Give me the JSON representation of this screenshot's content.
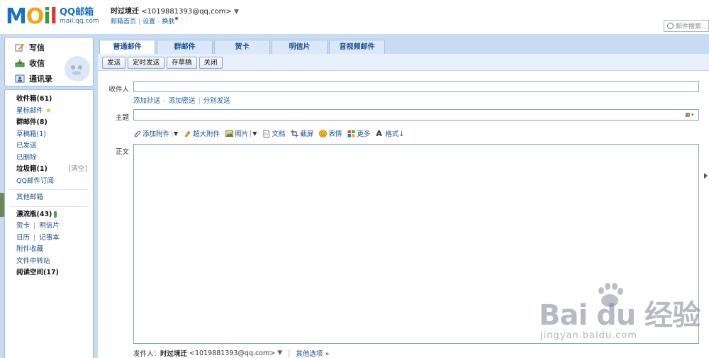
{
  "header": {
    "logo_text": "MOil",
    "logo_cn": "QQ邮箱",
    "logo_domain": "mail.qq.com",
    "user_name": "时过境迁",
    "user_email": "<1019881393@qq.com>",
    "links": [
      "邮箱首页",
      "设置",
      "换肤"
    ],
    "search_placeholder": "邮件搜索..."
  },
  "sidebar": {
    "top_items": [
      {
        "label": "写信",
        "icon": "compose-icon"
      },
      {
        "label": "收信",
        "icon": "inbox-icon"
      },
      {
        "label": "通讯录",
        "icon": "contacts-icon"
      }
    ],
    "folders": {
      "inbox": "收件箱(61)",
      "starred": "星标邮件",
      "group": "群邮件(8)",
      "drafts": "草稿箱(1)",
      "sent": "已发送",
      "deleted": "已删除",
      "spam": "垃圾箱(1)",
      "spam_action": "[清空]",
      "subscriptions": "QQ邮件订阅",
      "other": "其他邮箱",
      "bottle": "漂流瓶(43)",
      "card": "贺卡",
      "postcard": "明信片",
      "calendar": "日历",
      "notes": "记事本",
      "attach_collection": "附件收藏",
      "file_transfer": "文件中转站",
      "reading": "阅读空间(17)"
    }
  },
  "main": {
    "tabs": [
      "普通邮件",
      "群邮件",
      "贺卡",
      "明信片",
      "音视频邮件"
    ],
    "active_tab": 0,
    "toolbar": [
      "发送",
      "定时发送",
      "存草稿",
      "关闭"
    ],
    "to_label": "收件人",
    "to_value": "",
    "cc_links": [
      "添加抄送",
      "添加密送",
      "分别发送"
    ],
    "subject_label": "主题",
    "subject_value": "",
    "attach_bar": [
      {
        "label": "添加附件",
        "icon": "paperclip-icon",
        "dropdown": true
      },
      {
        "label": "超大附件",
        "icon": "large-attach-icon",
        "dropdown": false
      },
      {
        "label": "照片",
        "icon": "photo-icon",
        "dropdown": true
      },
      {
        "label": "文档",
        "icon": "document-icon",
        "dropdown": false
      },
      {
        "label": "截屏",
        "icon": "screenshot-icon",
        "dropdown": false
      },
      {
        "label": "表情",
        "icon": "emoji-icon",
        "dropdown": false
      },
      {
        "label": "更多",
        "icon": "more-icon",
        "dropdown": false
      },
      {
        "label": "格式↓",
        "icon": "format-icon",
        "dropdown": false
      }
    ],
    "body_label": "正文",
    "body_value": "",
    "sender_label": "发件人：",
    "sender_name": "时过境迁",
    "sender_email": "<1019881393@qq.com>",
    "other_options": "其他选项"
  },
  "watermark": {
    "main": "Bai du 经验",
    "sub": "jingyan.baidu.com"
  },
  "colors": {
    "frame_blue": "#c7dcf3",
    "link_blue": "#1a4f94",
    "logo_m": "#1a70c8",
    "logo_o": "#f2a31a",
    "logo_i": "#2ba238",
    "logo_l": "#e0362e"
  }
}
